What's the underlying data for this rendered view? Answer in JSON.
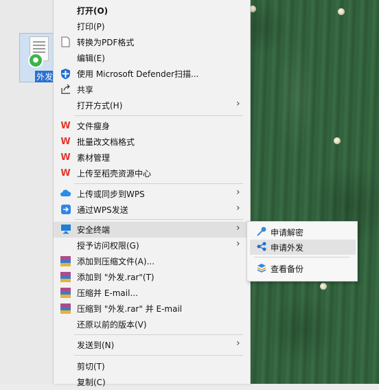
{
  "desktop": {
    "file_label": "外发"
  },
  "menu": {
    "items": [
      {
        "label": "打开(O)",
        "icon": "none"
      },
      {
        "label": "打印(P)",
        "icon": "none"
      },
      {
        "label": "转换为PDF格式",
        "icon": "blank-page-icon"
      },
      {
        "label": "编辑(E)",
        "icon": "none"
      },
      {
        "label": "使用 Microsoft Defender扫描...",
        "icon": "defender-shield-icon"
      },
      {
        "label": "共享",
        "icon": "share-icon"
      },
      {
        "label": "打开方式(H)",
        "icon": "none"
      },
      {
        "label": "文件瘦身",
        "icon": "wps-icon"
      },
      {
        "label": "批量改文档格式",
        "icon": "wps-icon"
      },
      {
        "label": "素材管理",
        "icon": "wps-icon"
      },
      {
        "label": "上传至稻壳资源中心",
        "icon": "wps-icon"
      },
      {
        "label": "上传或同步到WPS",
        "icon": "cloud-icon"
      },
      {
        "label": "通过WPS发送",
        "icon": "send-icon"
      },
      {
        "label": "安全终端",
        "icon": "monitor-icon"
      },
      {
        "label": "授予访问权限(G)",
        "icon": "none"
      },
      {
        "label": "添加到压缩文件(A)...",
        "icon": "winrar-icon"
      },
      {
        "label": "添加到 \"外发.rar\"(T)",
        "icon": "winrar-icon"
      },
      {
        "label": "压缩并 E-mail...",
        "icon": "winrar-icon"
      },
      {
        "label": "压缩到 \"外发.rar\" 并 E-mail",
        "icon": "winrar-icon"
      },
      {
        "label": "还原以前的版本(V)",
        "icon": "none"
      },
      {
        "label": "发送到(N)",
        "icon": "none"
      },
      {
        "label": "剪切(T)",
        "icon": "none"
      },
      {
        "label": "复制(C)",
        "icon": "none"
      }
    ]
  },
  "submenu": {
    "items": [
      {
        "label": "申请解密",
        "icon": "key-icon"
      },
      {
        "label": "申请外发",
        "icon": "share-nodes-icon"
      },
      {
        "label": "查看备份",
        "icon": "layers-icon"
      }
    ]
  },
  "colors": {
    "wps_red": "#e3372a",
    "accent_blue": "#2a6fcf",
    "lock_green": "#3bb54a"
  }
}
